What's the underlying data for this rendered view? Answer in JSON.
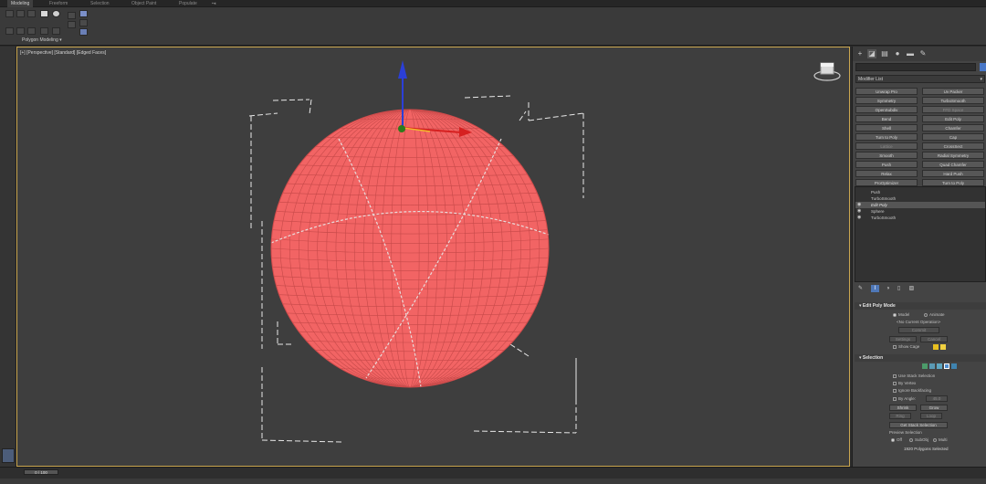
{
  "ribbon": {
    "tabs": [
      "Modeling",
      "Freeform",
      "Selection",
      "Object Paint",
      "Populate"
    ],
    "active_tab": "Modeling",
    "panel_label": "Polygon Modeling"
  },
  "viewport": {
    "label": "[+] [Perspective] [Standard] [Edged Faces]",
    "object_color": "#f26060",
    "wire_color": "#b84141",
    "border_color": "#caa650"
  },
  "command_panel": {
    "object_name": "",
    "modifier_list_label": "Modifier List",
    "modifier_buttons": [
      {
        "left": "Unwrap Pro",
        "right": "Uv Packer"
      },
      {
        "left": "Symmetry",
        "right": "TurboSmooth"
      },
      {
        "left": "OpenSubdiv",
        "right": "FFD Space",
        "right_dim": true
      },
      {
        "left": "Bend",
        "right": "Edit Poly"
      },
      {
        "left": "Shell",
        "right": "Chamfer"
      },
      {
        "left": "Turn to Poly",
        "right": "Cap"
      },
      {
        "left": "Lattice",
        "left_dim": true,
        "right": "CrossSect"
      },
      {
        "left": "Smooth",
        "right": "Radial Symmetry"
      },
      {
        "left": "Push",
        "right": "Quad Chamfer"
      },
      {
        "left": "Relax",
        "right": "Hard Push"
      },
      {
        "left": "ProOptimizer",
        "right": "Turn to Poly"
      }
    ],
    "stack": [
      {
        "label": "Push",
        "eye": false,
        "selected": false
      },
      {
        "label": "TurboSmooth",
        "eye": false,
        "selected": false
      },
      {
        "label": "Edit Poly",
        "eye": true,
        "selected": true
      },
      {
        "label": "Sphere",
        "eye": true,
        "selected": false
      },
      {
        "label": "TurboSmooth",
        "eye": true,
        "selected": false
      }
    ],
    "edit_poly_mode": {
      "title": "Edit Poly Mode",
      "model": "Model",
      "animate": "Animate",
      "current_op": "<No Current Operation>",
      "commit": "Commit",
      "settings": "Settings",
      "cancel": "Cancel",
      "show_cage": "Show Cage",
      "cage_colors": [
        "#e8c020",
        "#f0d040"
      ]
    },
    "selection": {
      "title": "Selection",
      "use_stack_selection": "Use Stack Selection",
      "by_vertex": "By Vertex",
      "ignore_backfacing": "Ignore Backfacing",
      "by_angle": "By Angle:",
      "by_angle_value": "45.0",
      "shrink": "Shrink",
      "grow": "Grow",
      "ring": "Ring",
      "loop": "Loop",
      "get_stack_selection": "Get Stack Selection",
      "preview_selection": "Preview Selection",
      "preview_off": "Off",
      "preview_subobj": "SubObj",
      "preview_multi": "Multi",
      "status": "1920 Polygons Selected"
    }
  },
  "timebar": {
    "frame": "0 / 100"
  }
}
